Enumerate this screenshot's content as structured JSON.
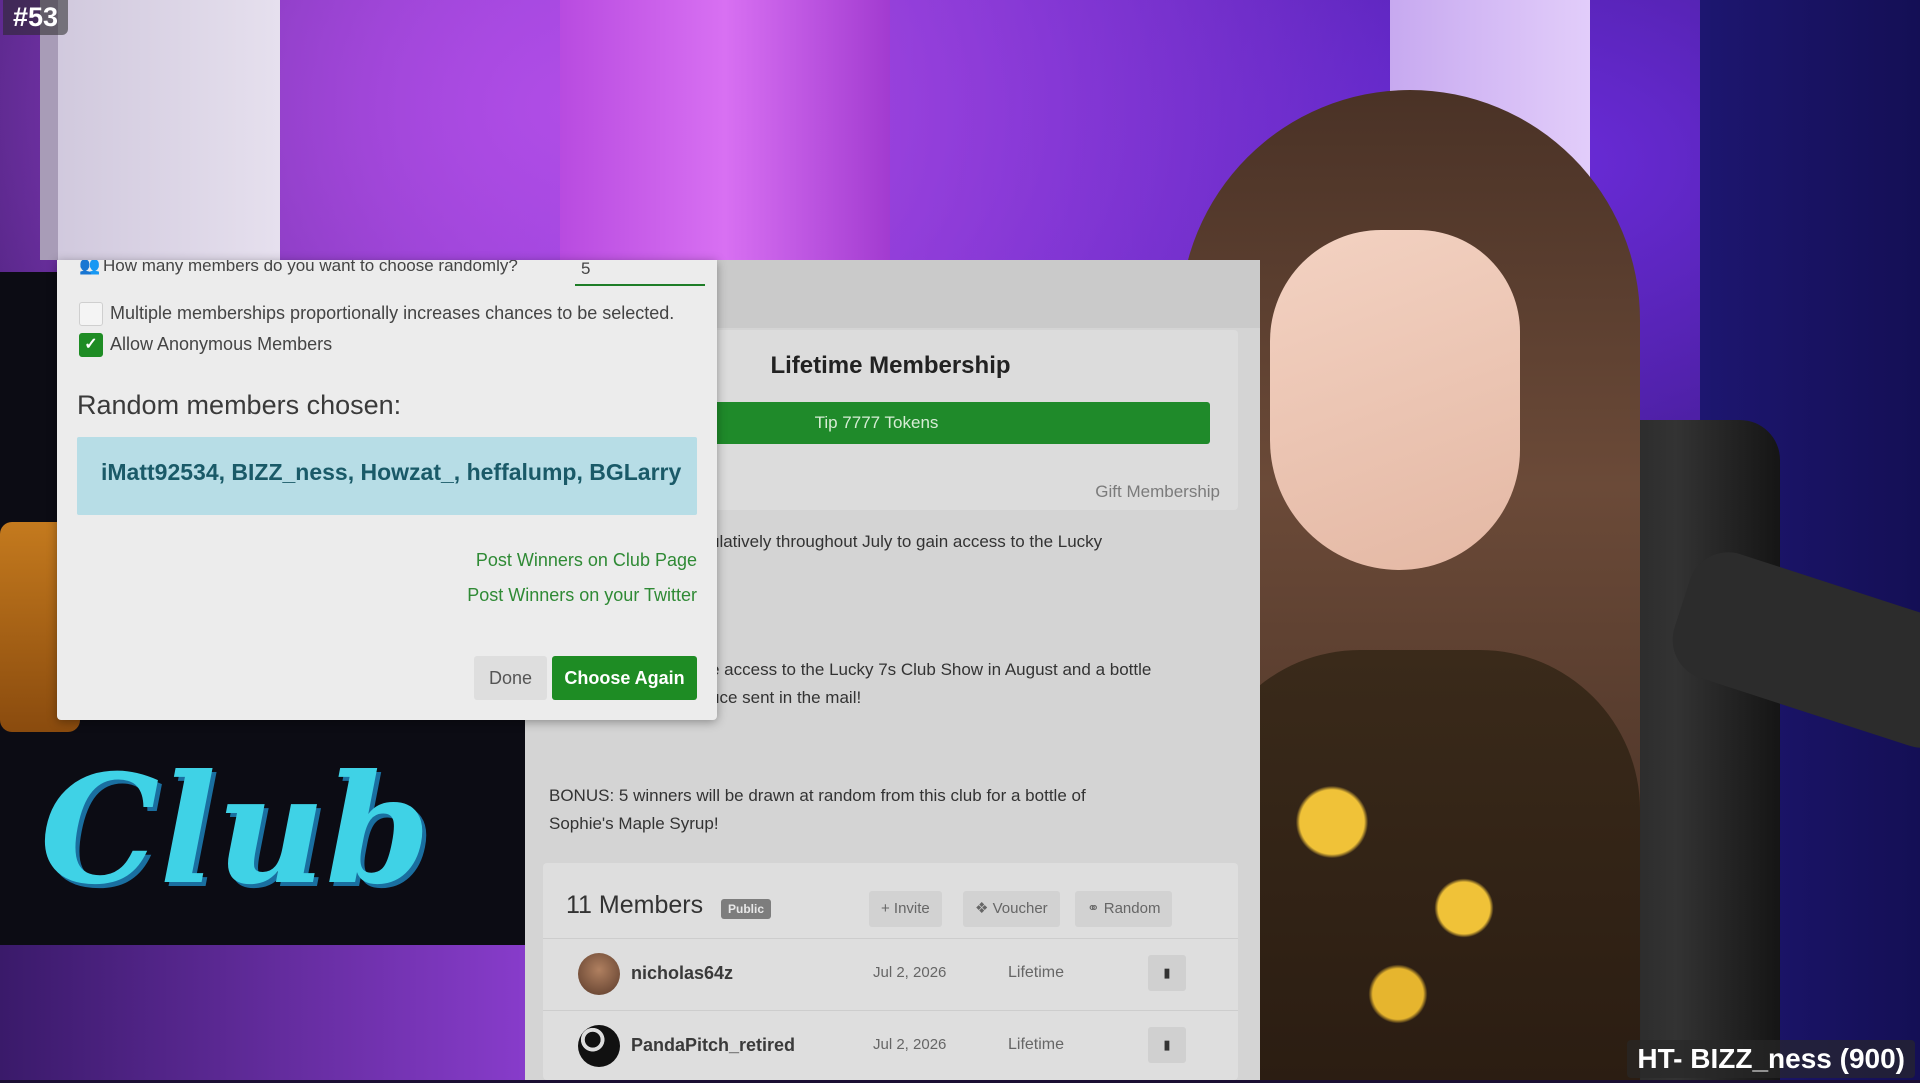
{
  "overlay": {
    "episode": "#53",
    "ticker": "HT- BIZZ_ness (900)"
  },
  "club_art": {
    "text": "Club"
  },
  "page": {
    "card_title": "Lifetime Membership",
    "tip_button": "Tip 7777 Tokens",
    "gift_link": "Gift Membership",
    "desc1": "ulatively throughout July to gain access to the Lucky",
    "desc2a": "e access to the Lucky 7s Club Show in August and a bottle",
    "desc2b": "uce sent in the mail!",
    "bonus_a": "BONUS: 5 winners will be drawn at random from this club for a bottle of",
    "bonus_b": "Sophie's Maple Syrup!",
    "members": {
      "title": "11 Members",
      "badge": "Public",
      "invite": "+ Invite",
      "voucher": "Voucher",
      "random": "Random",
      "rows": [
        {
          "name": "nicholas64z",
          "date": "Jul 2, 2026",
          "type": "Lifetime"
        },
        {
          "name": "PandaPitch_retired",
          "date": "Jul 2, 2026",
          "type": "Lifetime"
        }
      ]
    }
  },
  "modal": {
    "question": "How many members do you want to choose randomly?",
    "count_value": "5",
    "opt_multiple": "Multiple memberships proportionally increases chances to be selected.",
    "opt_anonymous": "Allow Anonymous Members",
    "opt_multiple_checked": false,
    "opt_anonymous_checked": true,
    "chosen_title": "Random members chosen:",
    "chosen_names": "iMatt92534, BIZZ_ness, Howzat_, heffalump, BGLarry",
    "post_club": "Post Winners on Club Page",
    "post_twitter": "Post Winners on your Twitter",
    "done": "Done",
    "choose_again": "Choose Again"
  },
  "colors": {
    "accent_green": "#1e8c24",
    "chosen_bg": "#b7dde6"
  }
}
